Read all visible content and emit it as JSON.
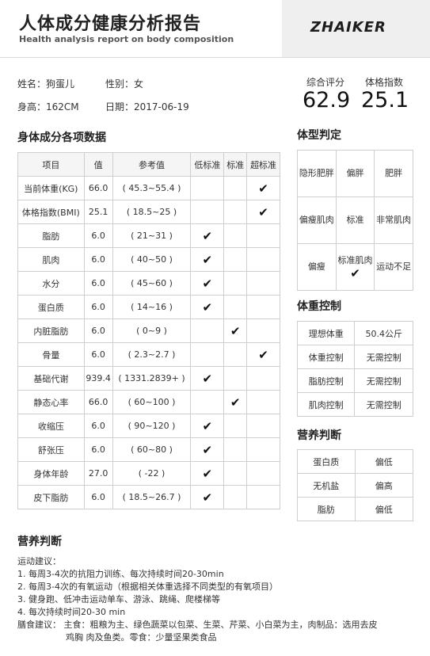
{
  "header": {
    "title": "人体成分健康分析报告",
    "subtitle": "Health analysis report on body composition",
    "logo": "ZHAIKER"
  },
  "person": {
    "name": "姓名：狗蛋儿",
    "gender": "性别：女",
    "height": "身高：162CM",
    "date": "日期：2017-06-19"
  },
  "scores": {
    "overall_label": "综合评分",
    "overall_value": "62.9",
    "bmi_label": "体格指数",
    "bmi_value": "25.1"
  },
  "composition": {
    "title": "身体成分各项数据",
    "headers": [
      "项目",
      "值",
      "参考值",
      "低标准",
      "标准",
      "超标准"
    ],
    "rows": [
      {
        "item": "当前体重(KG)",
        "value": "66.0",
        "ref": "( 45.3~55.4 )",
        "level": "high"
      },
      {
        "item": "体格指数(BMI)",
        "value": "25.1",
        "ref": "( 18.5~25 )",
        "level": "high"
      },
      {
        "item": "脂肪",
        "value": "6.0",
        "ref": "( 21~31 )",
        "level": "low"
      },
      {
        "item": "肌肉",
        "value": "6.0",
        "ref": "( 40~50 )",
        "level": "low"
      },
      {
        "item": "水分",
        "value": "6.0",
        "ref": "( 45~60 )",
        "level": "low"
      },
      {
        "item": "蛋白质",
        "value": "6.0",
        "ref": "( 14~16 )",
        "level": "low"
      },
      {
        "item": "内脏脂肪",
        "value": "6.0",
        "ref": "( 0~9 )",
        "level": "std"
      },
      {
        "item": "骨量",
        "value": "6.0",
        "ref": "( 2.3~2.7 )",
        "level": "high"
      },
      {
        "item": "基础代谢",
        "value": "939.4",
        "ref": "( 1331.2839+ )",
        "level": "low"
      },
      {
        "item": "静态心率",
        "value": "66.0",
        "ref": "( 60~100 )",
        "level": "std"
      },
      {
        "item": "收缩压",
        "value": "6.0",
        "ref": "( 90~120 )",
        "level": "low"
      },
      {
        "item": "舒张压",
        "value": "6.0",
        "ref": "( 60~80 )",
        "level": "low"
      },
      {
        "item": "身体年龄",
        "value": "27.0",
        "ref": "( -22 )",
        "level": "low"
      },
      {
        "item": "皮下脂肪",
        "value": "6.0",
        "ref": "( 18.5~26.7 )",
        "level": "low"
      }
    ]
  },
  "body_type": {
    "title": "体型判定",
    "cells": [
      [
        "隐形肥胖",
        "偏胖",
        "肥胖"
      ],
      [
        "偏瘦肌肉",
        "标准",
        "非常肌肉"
      ],
      [
        "偏瘦",
        "标准肌肉",
        "运动不足"
      ]
    ],
    "selected": "标准肌肉"
  },
  "weight_control": {
    "title": "体重控制",
    "rows": [
      {
        "label": "理想体重",
        "value": "50.4公斤"
      },
      {
        "label": "体重控制",
        "value": "无需控制"
      },
      {
        "label": "脂肪控制",
        "value": "无需控制"
      },
      {
        "label": "肌肉控制",
        "value": "无需控制"
      }
    ]
  },
  "nutrition": {
    "title": "营养判断",
    "rows": [
      {
        "label": "蛋白质",
        "value": "偏低"
      },
      {
        "label": "无机盐",
        "value": "偏高"
      },
      {
        "label": "脂肪",
        "value": "偏低"
      }
    ]
  },
  "advice": {
    "title": "营养判断",
    "sport_heading": "运动建议：",
    "sport_items": [
      "1. 每周3-4次的抗阻力训练、每次持续时间20-30min",
      "2. 每周3-4次的有氧运动（根据相关体重选择不同类型的有氧项目）",
      "3. 健身跑、低冲击运动单车、游泳、跳绳、爬楼梯等",
      "4. 每次持续时间20-30 min"
    ],
    "diet_line1": "膳食建议：  主食：粗粮为主、绿色蔬菜以包菜、生菜、芹菜、小白菜为主，肉制品：选用去皮",
    "diet_line2": "鸡胸 肉及鱼类。零食：少量坚果类食品"
  },
  "check_mark": "✔"
}
